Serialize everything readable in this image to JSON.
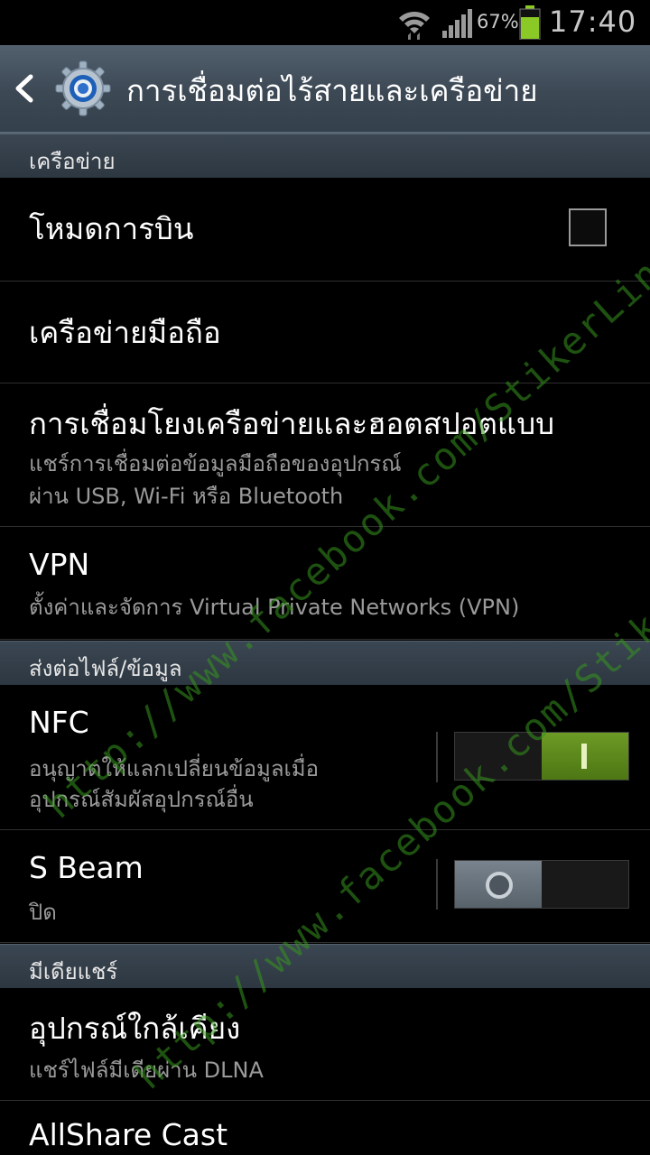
{
  "status_bar": {
    "battery_percent": "67%",
    "time": "17:40"
  },
  "action_bar": {
    "title": "การเชื่อมต่อไร้สายและเครือข่าย"
  },
  "sections": {
    "network": "เครือข่าย",
    "file_transfer": "ส่งต่อไฟล์/ข้อมูล",
    "media_share": "มีเดียแชร์"
  },
  "rows": {
    "airplane": {
      "title": "โหมดการบิน",
      "checked": false
    },
    "mobile_network": {
      "title": "เครือข่ายมือถือ"
    },
    "tethering": {
      "title": "การเชื่อมโยงเครือข่ายและฮอตสปอตแบบ",
      "sub1": "แชร์การเชื่อมต่อข้อมูลมือถือของอุปกรณ์",
      "sub2": "ผ่าน USB, Wi-Fi หรือ Bluetooth"
    },
    "vpn": {
      "title": "VPN",
      "sub": "ตั้งค่าและจัดการ Virtual Private Networks (VPN)"
    },
    "nfc": {
      "title": "NFC",
      "sub1": "อนุญาตให้แลกเปลี่ยนข้อมูลเมื่อ",
      "sub2": "อุปกรณ์สัมผัสอุปกรณ์อื่น",
      "state": "on"
    },
    "sbeam": {
      "title": "S Beam",
      "sub": "ปิด",
      "state": "off"
    },
    "nearby": {
      "title": "อุปกรณ์ใกล้เคียง",
      "sub": "แชร์ไฟล์มีเดียผ่าน DLNA"
    },
    "allshare": {
      "title": "AllShare Cast"
    }
  },
  "watermark": {
    "text1": "http://www.facebook.com/StikerLineDD",
    "text2": "http://www.facebook.com/StikerLineDD"
  },
  "colors": {
    "action_bar": "#3c4854",
    "switch_on": "#5a8a1c",
    "watermark": "#37961e"
  }
}
